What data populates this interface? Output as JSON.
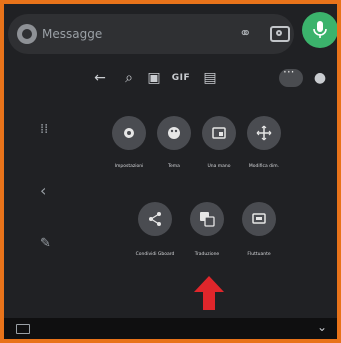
{
  "message_bar": {
    "placeholder": "Messagge"
  },
  "toolbar": {
    "gif_label": "GIF"
  },
  "tiles_row1": [
    {
      "icon": "gear-icon",
      "label": "Impostazioni"
    },
    {
      "icon": "palette-icon",
      "label": "Tema"
    },
    {
      "icon": "one-handed-icon",
      "label": "Una mano"
    },
    {
      "icon": "move-icon",
      "label": "Modifica dim."
    }
  ],
  "tiles_row2": [
    {
      "icon": "share-icon",
      "label": "Condividi Gboard"
    },
    {
      "icon": "translate-icon",
      "label": "Traduzione"
    },
    {
      "icon": "floating-icon",
      "label": "Fluttuante"
    }
  ],
  "colors": {
    "border": "#e8731a",
    "background": "#202124",
    "tile": "#4a4c51",
    "accent_green": "#3bb36c",
    "arrow_red": "#e0262b"
  }
}
